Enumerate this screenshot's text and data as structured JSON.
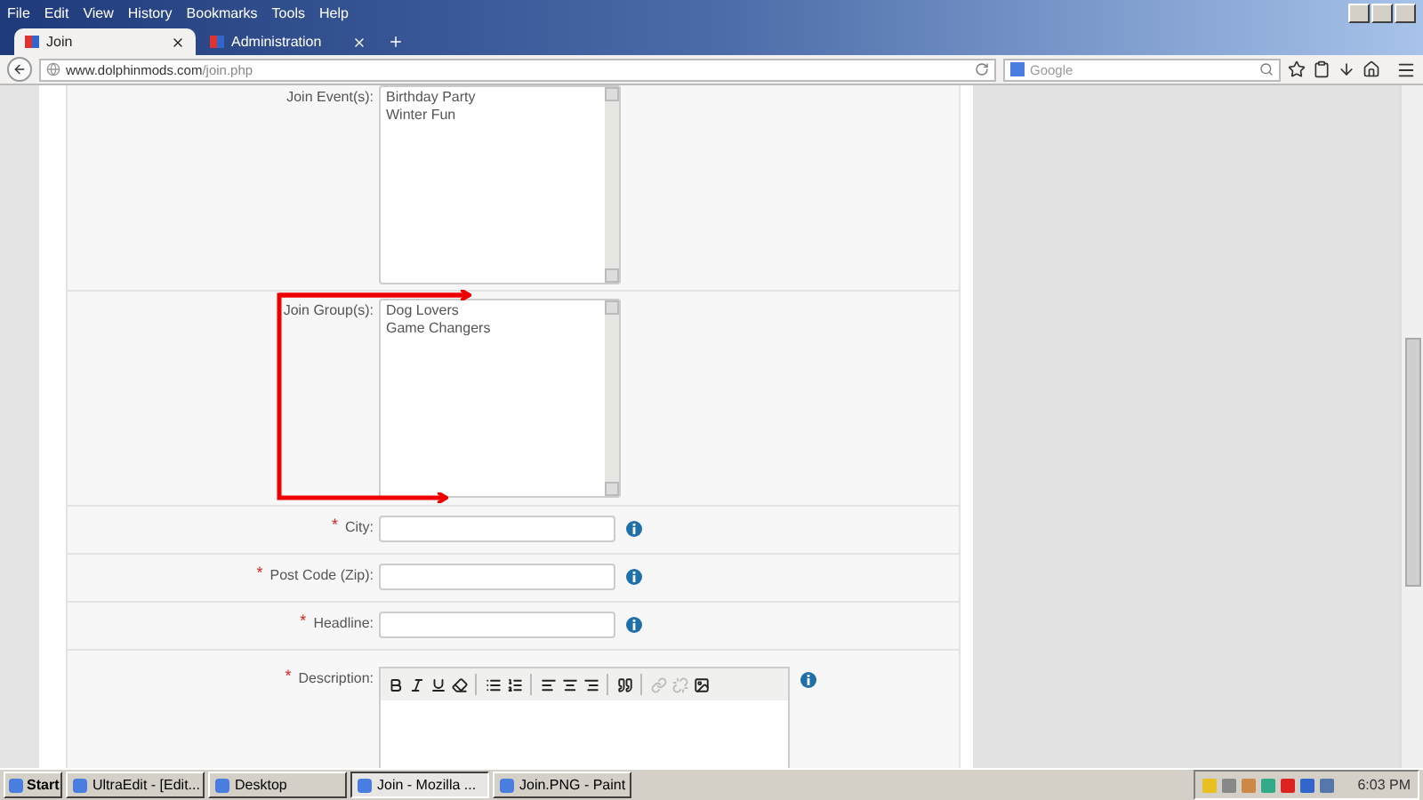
{
  "menu": [
    "File",
    "Edit",
    "View",
    "History",
    "Bookmarks",
    "Tools",
    "Help"
  ],
  "tabs": [
    {
      "label": "Join",
      "selected": true
    },
    {
      "label": "Administration",
      "selected": false
    }
  ],
  "address": {
    "host": "www.dolphinmods.com",
    "path": "/join.php"
  },
  "search": {
    "placeholder": "Google"
  },
  "form": [
    {
      "kind": "listbox",
      "label": "Join Event(s):",
      "required": false,
      "items": [
        "Birthday Party",
        "Winter Fun"
      ]
    },
    {
      "kind": "listbox",
      "label": "Join Group(s):",
      "required": false,
      "items": [
        "Dog Lovers",
        "Game Changers"
      ]
    },
    {
      "kind": "text",
      "label": "City:",
      "required": true
    },
    {
      "kind": "text",
      "label": "Post Code (Zip):",
      "required": true
    },
    {
      "kind": "text",
      "label": "Headline:",
      "required": true
    },
    {
      "kind": "editor",
      "label": "Description:",
      "required": true,
      "tool_groups": [
        [
          {
            "disabled": false
          },
          {
            "disabled": false
          },
          {
            "disabled": false
          },
          {
            "disabled": false
          }
        ],
        [
          {
            "disabled": false
          },
          {
            "disabled": false
          }
        ],
        [
          {
            "disabled": false
          },
          {
            "disabled": false
          },
          {
            "disabled": false
          }
        ],
        [
          {
            "disabled": false
          }
        ],
        [
          {
            "disabled": true
          },
          {
            "disabled": true
          },
          {
            "disabled": false
          }
        ]
      ]
    }
  ],
  "required_mark": "*",
  "taskbar": {
    "start": "Start",
    "items": [
      {
        "label": "UltraEdit - [Edit...",
        "selected": false
      },
      {
        "label": "Desktop",
        "selected": false
      },
      {
        "label": "Join - Mozilla ...",
        "selected": true
      },
      {
        "label": "Join.PNG - Paint",
        "selected": false
      }
    ],
    "clock": "6:03 PM"
  }
}
